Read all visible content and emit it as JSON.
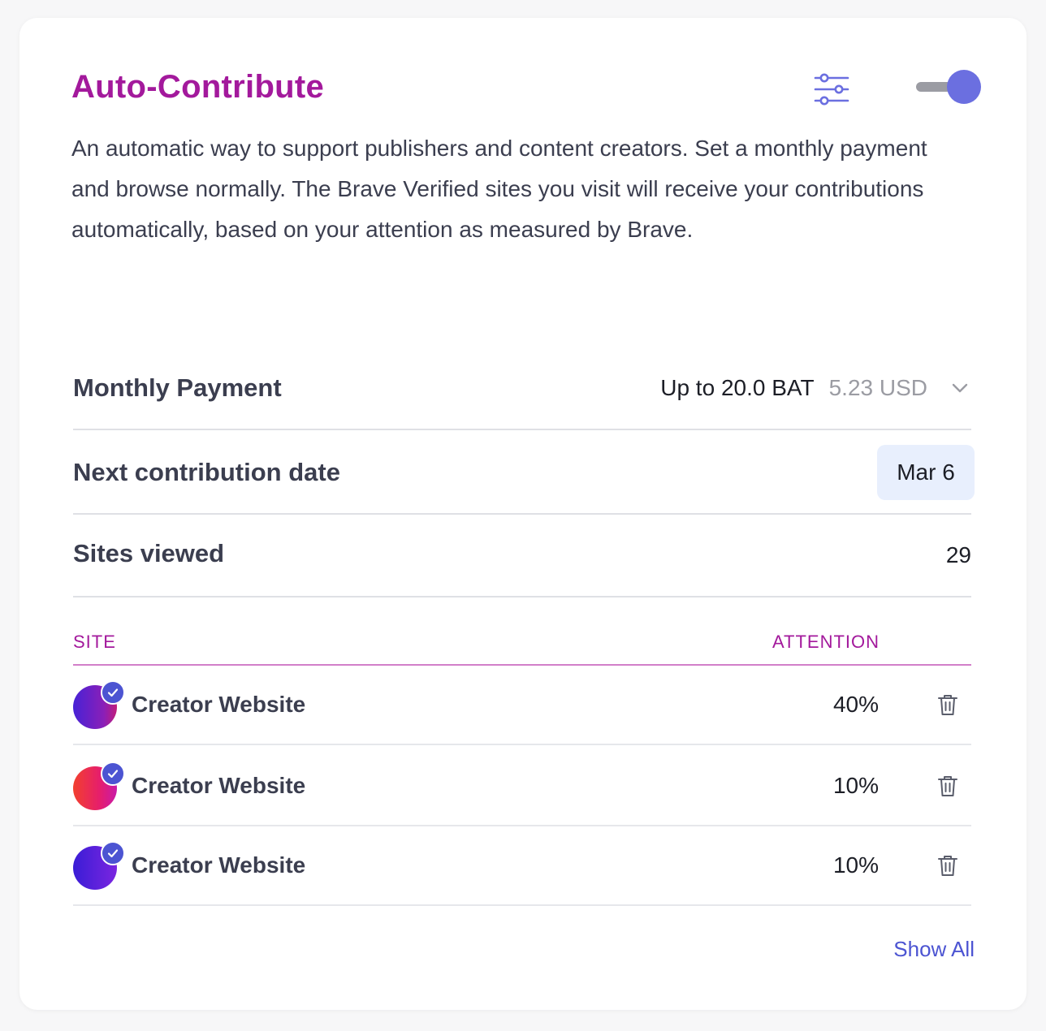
{
  "header": {
    "title": "Auto-Contribute",
    "settings_icon": "sliders-icon",
    "toggle_on": true
  },
  "description": "An automatic way to support publishers and content creators. Set a monthly payment and browse normally. The Brave Verified sites you visit will receive your contributions automatically, based on your attention as measured by Brave.",
  "monthly_payment": {
    "label": "Monthly Payment",
    "bat_value": "Up to 20.0 BAT",
    "usd_value": "5.23 USD"
  },
  "next_contribution": {
    "label": "Next contribution date",
    "date": "Mar 6"
  },
  "sites_viewed": {
    "label": "Sites viewed",
    "count": "29"
  },
  "table": {
    "col_site": "SITE",
    "col_attention": "ATTENTION",
    "rows": [
      {
        "name": "Creator Website",
        "attention": "40%",
        "verified": true
      },
      {
        "name": "Creator Website",
        "attention": "10%",
        "verified": true
      },
      {
        "name": "Creator Website",
        "attention": "10%",
        "verified": true
      }
    ]
  },
  "show_all": "Show All",
  "colors": {
    "title": "#a3199c",
    "accent": "#4c54d2",
    "toggle_knob": "#6b6fe0",
    "date_badge_bg": "#e8effd"
  }
}
